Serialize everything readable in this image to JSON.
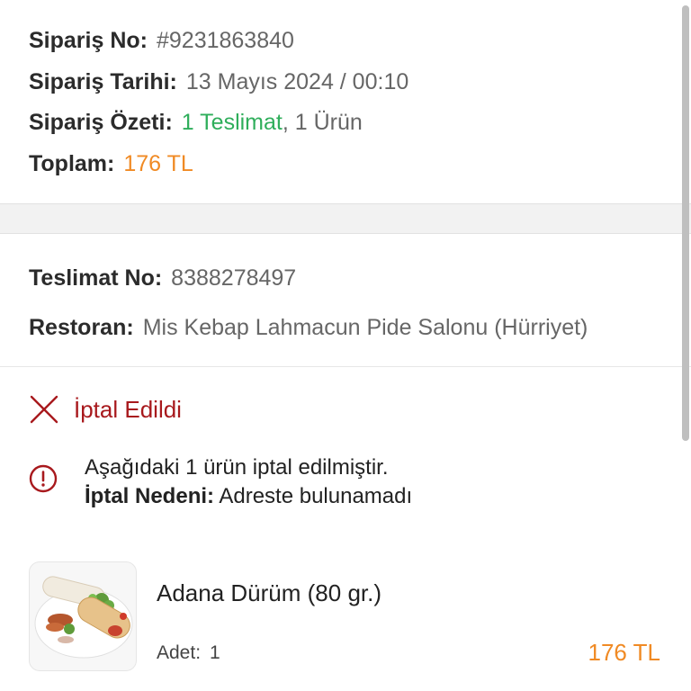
{
  "order": {
    "no_label": "Sipariş No:",
    "no_value": "#9231863840",
    "date_label": "Sipariş Tarihi:",
    "date_value": "13 Mayıs 2024 / 00:10",
    "summary_label": "Sipariş Özeti:",
    "summary_delivery": "1 Teslimat",
    "summary_items": ", 1 Ürün",
    "total_label": "Toplam:",
    "total_value": "176 TL"
  },
  "delivery": {
    "no_label": "Teslimat No:",
    "no_value": "8388278497",
    "restaurant_label": "Restoran:",
    "restaurant_value": "Mis Kebap Lahmacun Pide Salonu (Hürriyet)"
  },
  "status": {
    "icon": "close-icon",
    "label": "İptal Edildi",
    "color": "#a8191d"
  },
  "notice": {
    "icon": "info-icon",
    "line1": "Aşağıdaki 1 ürün iptal edilmiştir.",
    "reason_label": "İptal Nedeni:",
    "reason_value": "Adreste bulunamadı"
  },
  "product": {
    "name": "Adana Dürüm (80 gr.)",
    "qty_label": "Adet:",
    "qty_value": "1",
    "price": "176 TL"
  },
  "colors": {
    "accent_orange": "#f08a24",
    "green": "#2fae5b",
    "cancel_red": "#a8191d"
  }
}
